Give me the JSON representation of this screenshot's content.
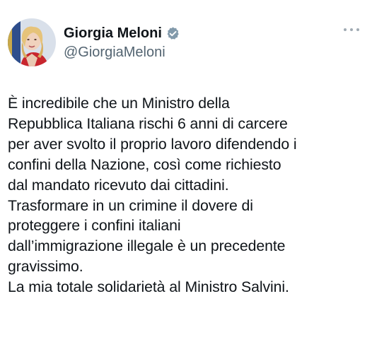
{
  "tweet": {
    "display_name": "Giorgia Meloni",
    "handle": "@GiorgiaMeloni",
    "verified_icon": "verified-badge-icon",
    "more_icon": "more-options-icon",
    "lines": [
      "È incredibile che un Ministro della",
      "Repubblica Italiana rischi 6 anni di carcere",
      "per aver svolto il proprio lavoro difendendo i",
      "confini della Nazione, così come richiesto",
      "dal mandato ricevuto dai cittadini.",
      "Trasformare in un crimine il dovere di",
      "proteggere i confini italiani",
      "dall’immigrazione illegale è un precedente",
      "gravissimo.",
      "La mia totale solidarietà al Ministro Salvini."
    ]
  },
  "colors": {
    "text": "#0f1419",
    "secondary": "#536471",
    "verified_gray": "#829aab",
    "dots": "#a0aab3"
  }
}
